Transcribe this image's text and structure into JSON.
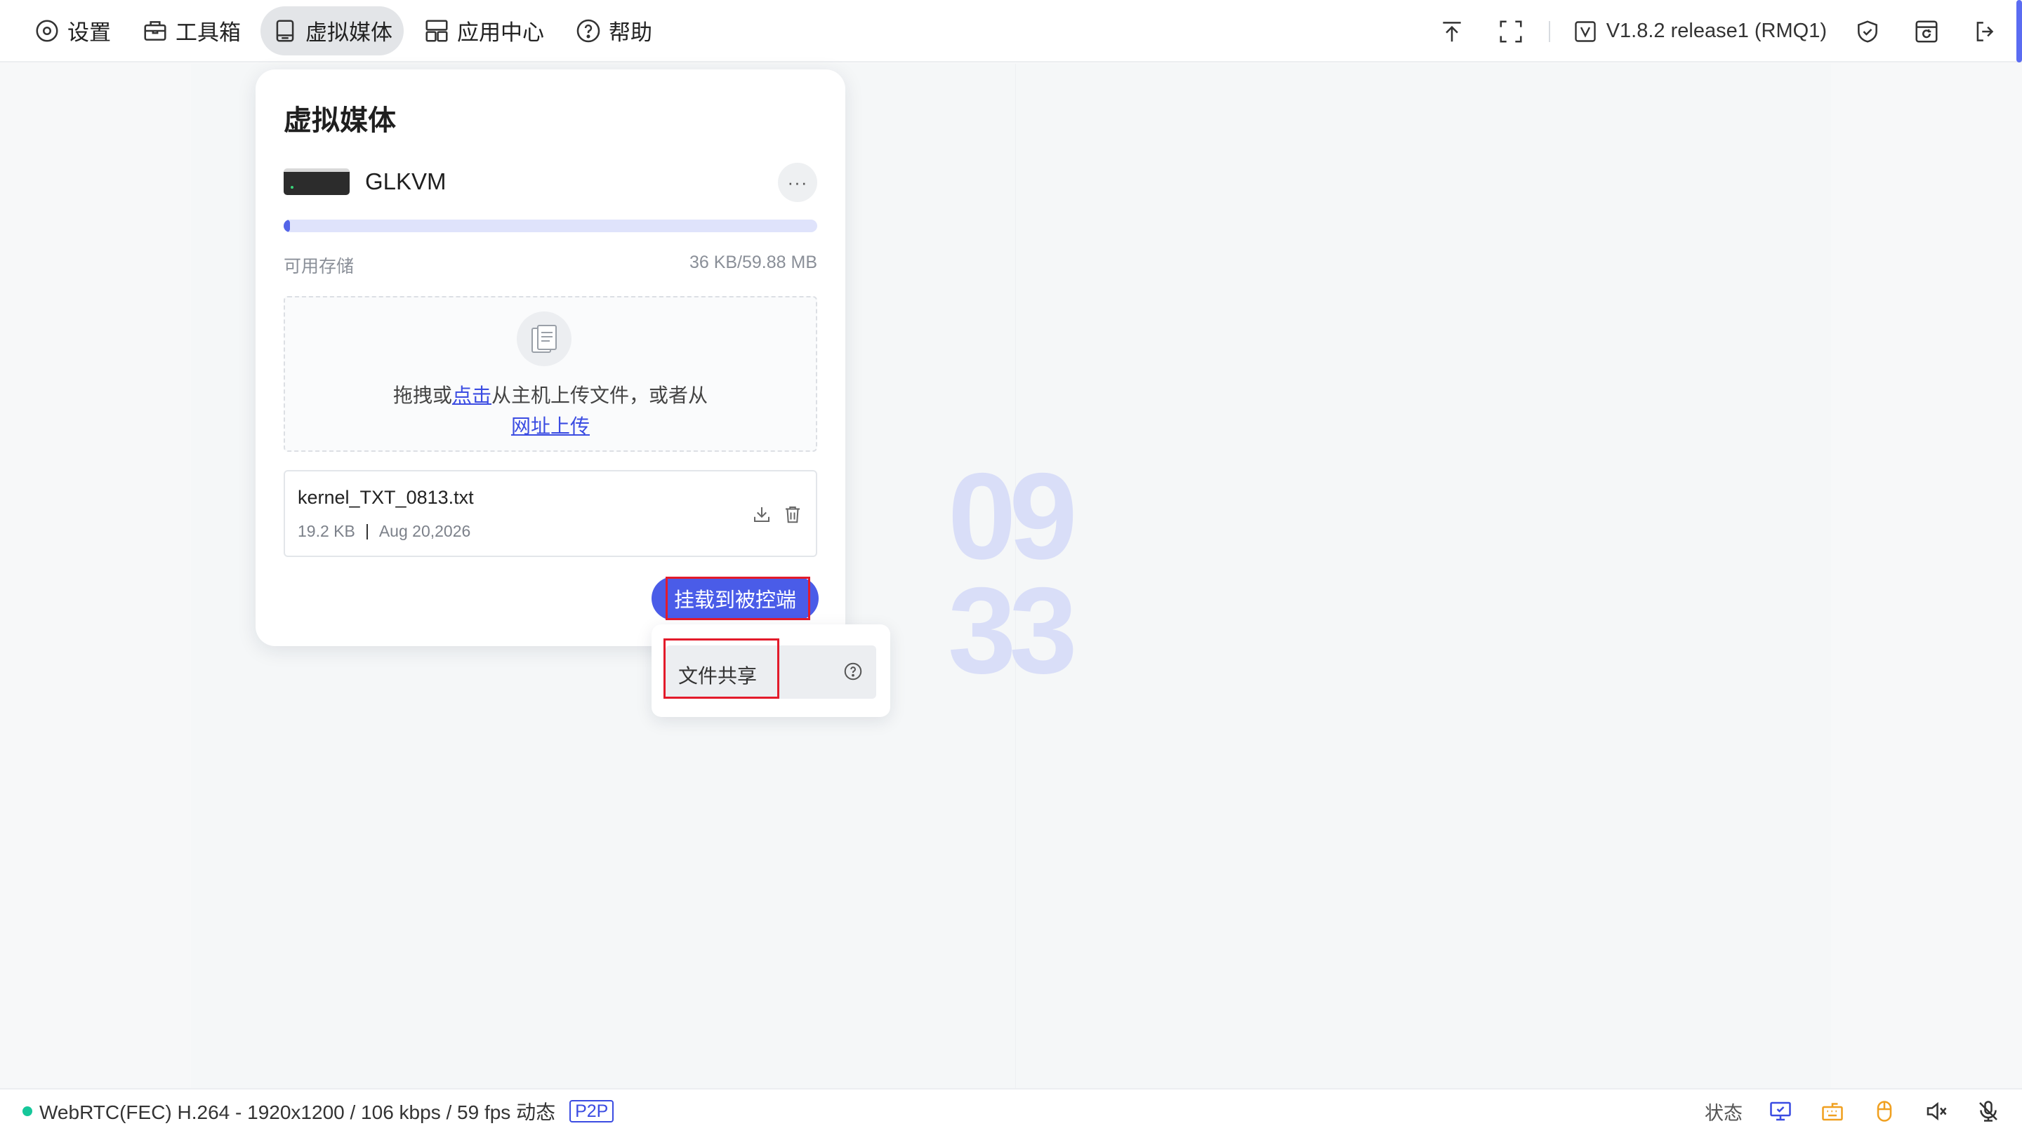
{
  "nav": [
    {
      "label": "设置",
      "icon": "settings-icon"
    },
    {
      "label": "工具箱",
      "icon": "toolbox-icon"
    },
    {
      "label": "虚拟媒体",
      "icon": "media-drive-icon",
      "active": true
    },
    {
      "label": "应用中心",
      "icon": "app-center-icon"
    },
    {
      "label": "帮助",
      "icon": "help-circle-icon"
    }
  ],
  "topright": {
    "version": "V1.8.2 release1 (RMQ1)",
    "icons": [
      "upload-arrow-icon",
      "fullscreen-icon",
      "version-check-icon",
      "shield-check-icon",
      "browser-refresh-icon",
      "logout-icon"
    ]
  },
  "panel": {
    "title": "虚拟媒体",
    "device_name": "GLKVM",
    "more_label": "···",
    "storage_label": "可用存储",
    "storage_value": "36 KB/59.88 MB",
    "storage_used_fraction": 0.0006,
    "dropzone": {
      "prefix": "拖拽或",
      "click_link": "点击",
      "suffix": "从主机上传文件，或者从",
      "url_link": "网址上传"
    },
    "file": {
      "name": "kernel_TXT_0813.txt",
      "size": "19.2 KB",
      "date": "Aug 20,2026"
    },
    "mount_button": "挂载到被控端"
  },
  "popover": {
    "item_label": "文件共享"
  },
  "clock": {
    "hours": "09",
    "minutes": "33"
  },
  "statusbar": {
    "stream": "WebRTC(FEC) H.264 - 1920x1200 / 106 kbps / 59 fps 动态",
    "badge": "P2P",
    "status_label": "状态",
    "status_color": "#16c79a",
    "accent_color": "#4a5ce8"
  }
}
